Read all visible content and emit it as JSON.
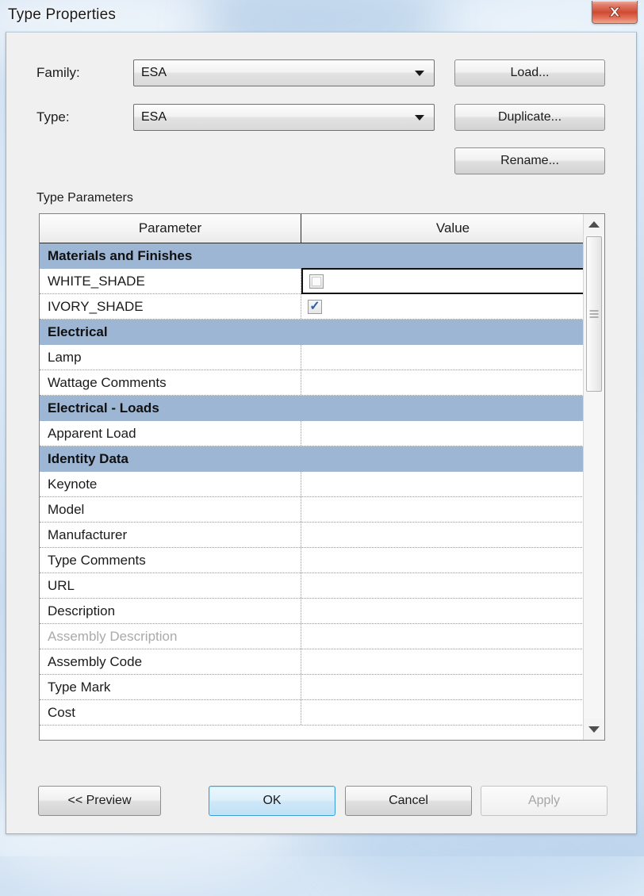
{
  "window": {
    "title": "Type Properties",
    "close_label": "Close",
    "close_icon": "close-icon"
  },
  "form": {
    "family": {
      "label": "Family:",
      "value": "ESA",
      "arrow_icon": "chevron-down-icon"
    },
    "type": {
      "label": "Type:",
      "value": "ESA",
      "arrow_icon": "chevron-down-icon"
    },
    "buttons": {
      "load": "Load...",
      "duplicate": "Duplicate...",
      "rename": "Rename..."
    }
  },
  "parameters_section": {
    "title": "Type Parameters",
    "columns": {
      "parameter": "Parameter",
      "value": "Value"
    },
    "collapse_icon": "double-chevron-up-icon",
    "rows": [
      {
        "kind": "group",
        "label": "Materials and Finishes"
      },
      {
        "kind": "data",
        "label": "WHITE_SHADE",
        "value_type": "checkbox",
        "checked": false,
        "focused": true,
        "disabled": false
      },
      {
        "kind": "data",
        "label": "IVORY_SHADE",
        "value_type": "checkbox",
        "checked": true,
        "focused": false,
        "disabled": false
      },
      {
        "kind": "group",
        "label": "Electrical"
      },
      {
        "kind": "data",
        "label": "Lamp",
        "value_type": "text",
        "value": "",
        "disabled": false
      },
      {
        "kind": "data",
        "label": "Wattage Comments",
        "value_type": "text",
        "value": "",
        "disabled": false
      },
      {
        "kind": "group",
        "label": "Electrical - Loads"
      },
      {
        "kind": "data",
        "label": "Apparent Load",
        "value_type": "text",
        "value": "",
        "disabled": false
      },
      {
        "kind": "group",
        "label": "Identity Data"
      },
      {
        "kind": "data",
        "label": "Keynote",
        "value_type": "text",
        "value": "",
        "disabled": false
      },
      {
        "kind": "data",
        "label": "Model",
        "value_type": "text",
        "value": "",
        "disabled": false
      },
      {
        "kind": "data",
        "label": "Manufacturer",
        "value_type": "text",
        "value": "",
        "disabled": false
      },
      {
        "kind": "data",
        "label": "Type Comments",
        "value_type": "text",
        "value": "",
        "disabled": false
      },
      {
        "kind": "data",
        "label": "URL",
        "value_type": "text",
        "value": "",
        "disabled": false
      },
      {
        "kind": "data",
        "label": "Description",
        "value_type": "text",
        "value": "",
        "disabled": false
      },
      {
        "kind": "data",
        "label": "Assembly Description",
        "value_type": "text",
        "value": "",
        "disabled": true
      },
      {
        "kind": "data",
        "label": "Assembly Code",
        "value_type": "text",
        "value": "",
        "disabled": false
      },
      {
        "kind": "data",
        "label": "Type Mark",
        "value_type": "text",
        "value": "",
        "disabled": false
      },
      {
        "kind": "data",
        "label": "Cost",
        "value_type": "text",
        "value": "",
        "disabled": false
      }
    ],
    "scrollbar": {
      "up_icon": "triangle-up-icon",
      "down_icon": "triangle-down-icon",
      "thumb_position": "top"
    }
  },
  "footer": {
    "preview": "<< Preview",
    "ok": "OK",
    "cancel": "Cancel",
    "apply": "Apply",
    "apply_disabled": true,
    "ok_is_default": true
  },
  "colors": {
    "group_header": "#9db6d4",
    "default_button_border": "#3c9bd4",
    "close_button": "#cf4a32",
    "dialog_background": "#f0f0f0",
    "checkmark": "#2c5fa8",
    "disabled_text": "#aaaaaa"
  }
}
